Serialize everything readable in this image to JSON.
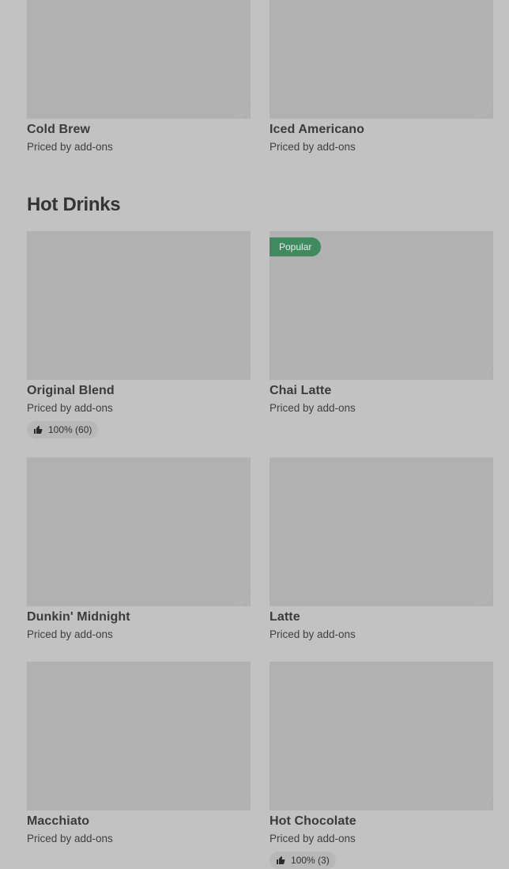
{
  "top_row": [
    {
      "name": "Cold Brew",
      "price": "Priced by add-ons"
    },
    {
      "name": "Iced Americano",
      "price": "Priced by add-ons"
    }
  ],
  "section": {
    "title": "Hot Drinks",
    "items": [
      {
        "name": "Original Blend",
        "price": "Priced by add-ons",
        "rating": "100% (60)"
      },
      {
        "name": "Chai Latte",
        "price": "Priced by add-ons",
        "badge": "Popular"
      },
      {
        "name": "Dunkin' Midnight",
        "price": "Priced by add-ons"
      },
      {
        "name": "Latte",
        "price": "Priced by add-ons"
      },
      {
        "name": "Macchiato",
        "price": "Priced by add-ons"
      },
      {
        "name": "Hot Chocolate",
        "price": "Priced by add-ons",
        "rating": "100% (3)"
      }
    ]
  },
  "colors": {
    "background": "#c2c2c2",
    "placeholder": "#b1b1b1",
    "badge": "#3f8a5e"
  },
  "icons": {
    "rating": "thumbs-up-icon"
  }
}
